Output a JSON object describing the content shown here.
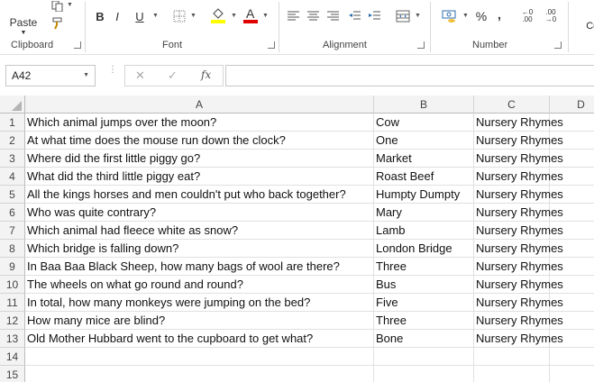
{
  "ribbon": {
    "paste_label": "Paste",
    "groups": {
      "clipboard": "Clipboard",
      "font": "Font",
      "alignment": "Alignment",
      "number": "Number",
      "styles_partial": "Cor\nFor"
    },
    "font_buttons": {
      "bold": "B",
      "italic": "I",
      "underline": "U"
    },
    "number": {
      "percent": "%",
      "comma": ",",
      "inc_decimal": "←0 .00",
      "dec_decimal": ".00 →0"
    },
    "colors": {
      "highlight": "#ffff00",
      "font_color": "#e00000",
      "accent": "#217346"
    }
  },
  "formula_bar": {
    "name_box": "A42",
    "cancel_icon": "✕",
    "enter_icon": "✓",
    "fx_label": "fx",
    "formula_value": ""
  },
  "sheet": {
    "columns": [
      "A",
      "B",
      "C",
      "D"
    ],
    "rows": [
      {
        "num": "1",
        "a": "Which animal jumps over the moon?",
        "b": "Cow",
        "c": "Nursery Rhymes"
      },
      {
        "num": "2",
        "a": "At what time does the mouse run down the clock?",
        "b": "One",
        "c": "Nursery Rhymes"
      },
      {
        "num": "3",
        "a": "Where did the first little piggy go?",
        "b": "Market",
        "c": "Nursery Rhymes"
      },
      {
        "num": "4",
        "a": "What did the third little piggy eat?",
        "b": "Roast Beef",
        "c": "Nursery Rhymes"
      },
      {
        "num": "5",
        "a": "All the kings horses and men couldn't put who back together?",
        "b": "Humpty Dumpty",
        "c": "Nursery Rhymes"
      },
      {
        "num": "6",
        "a": "Who was quite contrary?",
        "b": "Mary",
        "c": "Nursery Rhymes"
      },
      {
        "num": "7",
        "a": "Which animal had fleece white as snow?",
        "b": "Lamb",
        "c": "Nursery Rhymes"
      },
      {
        "num": "8",
        "a": "Which bridge is falling down?",
        "b": "London Bridge",
        "c": "Nursery Rhymes"
      },
      {
        "num": "9",
        "a": "In Baa Baa Black Sheep, how many bags of wool are there?",
        "b": "Three",
        "c": "Nursery Rhymes"
      },
      {
        "num": "10",
        "a": "The wheels on what go round and round?",
        "b": "Bus",
        "c": "Nursery Rhymes"
      },
      {
        "num": "11",
        "a": "In total, how many monkeys were jumping on the bed?",
        "b": "Five",
        "c": "Nursery Rhymes"
      },
      {
        "num": "12",
        "a": "How many mice are blind?",
        "b": "Three",
        "c": "Nursery Rhymes"
      },
      {
        "num": "13",
        "a": "Old Mother Hubbard went to the cupboard to get what?",
        "b": "Bone",
        "c": "Nursery Rhymes"
      },
      {
        "num": "14",
        "a": "",
        "b": "",
        "c": ""
      },
      {
        "num": "15",
        "a": "",
        "b": "",
        "c": ""
      }
    ]
  }
}
